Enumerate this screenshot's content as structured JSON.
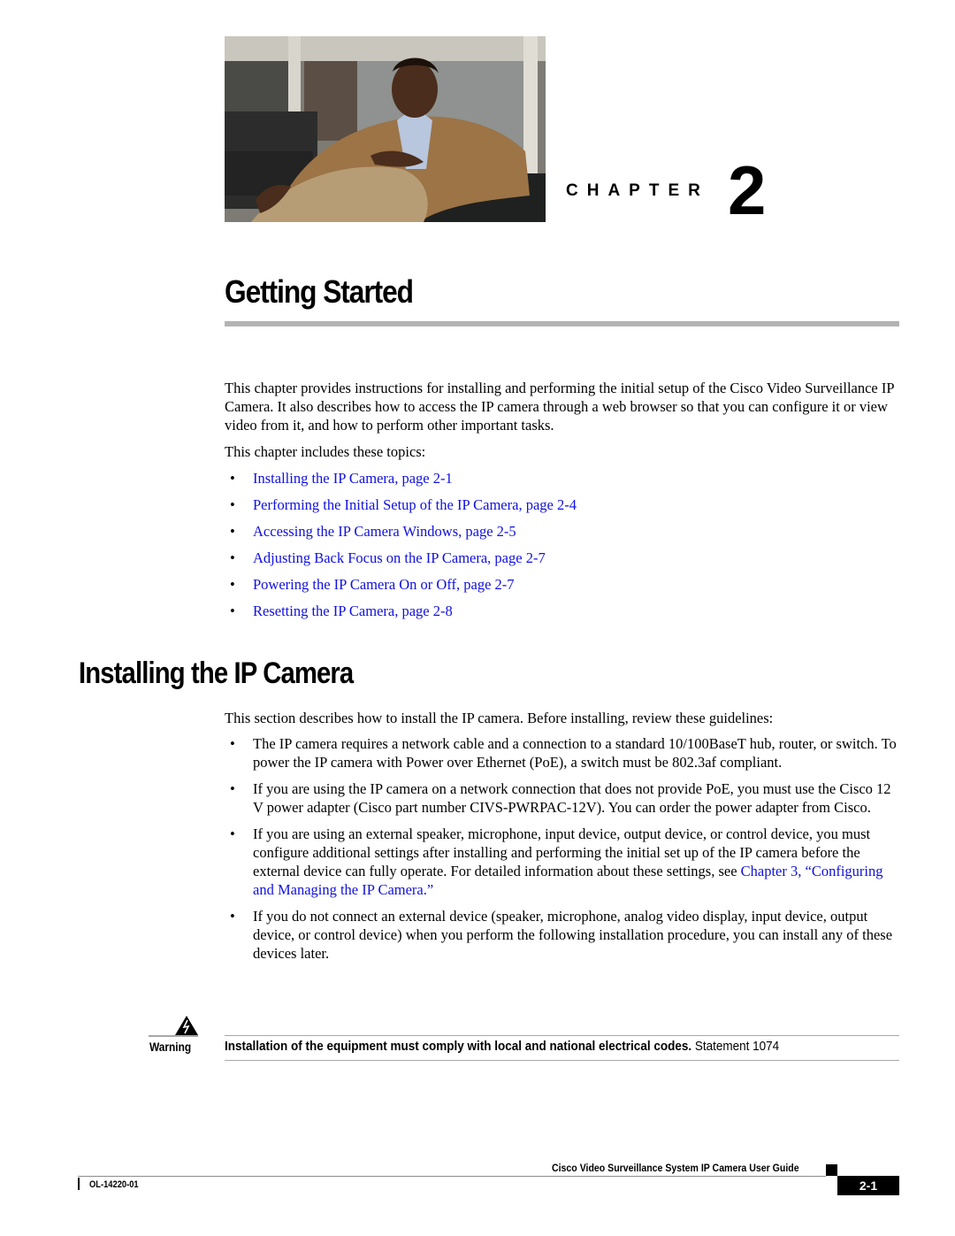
{
  "chapter": {
    "label": "CHAPTER",
    "number": "2",
    "title": "Getting Started",
    "photo_description": "portrait-photo-man-seated-in-office"
  },
  "intro": {
    "paragraph": "This chapter provides instructions for installing and performing the initial setup of the Cisco Video Surveillance IP Camera. It also describes how to access the IP camera through a web browser so that you can configure it or view video from it, and how to perform other important tasks.",
    "topics_lead": "This chapter includes these topics:",
    "topics": [
      {
        "label": "Installing the IP Camera, page 2-1"
      },
      {
        "label": "Performing the Initial Setup of the IP Camera, page 2-4"
      },
      {
        "label": "Accessing the IP Camera Windows, page 2-5"
      },
      {
        "label": "Adjusting Back Focus on the IP Camera, page 2-7"
      },
      {
        "label": "Powering the IP Camera On or Off, page 2-7"
      },
      {
        "label": "Resetting the IP Camera, page 2-8"
      }
    ],
    "bullet": "•"
  },
  "section": {
    "title": "Installing the IP Camera",
    "intro": "This section describes how to install the IP camera. Before installing, review these guidelines:",
    "guidelines": [
      {
        "text": "The IP camera requires a network cable and a connection to a standard 10/100BaseT hub, router, or switch. To power the IP camera with Power over Ethernet (PoE), a switch must be 802.3af compliant."
      },
      {
        "text": "If you are using the IP camera on a network connection that does not provide PoE, you must use the Cisco 12 V power adapter (Cisco part number CIVS-PWRPAC-12V). You can order the power adapter from Cisco."
      },
      {
        "text": "If you are using an external speaker, microphone, input device, output device, or control device, you must configure additional settings after installing and performing the initial set up of the IP camera before the external device can fully operate. For detailed information about these settings, see ",
        "link": "Chapter 3, “Configuring and Managing the IP Camera.”"
      },
      {
        "text": "If you do not connect an external device (speaker, microphone, analog video display, input device, output device, or control device) when you perform the following installation procedure, you can install any of these devices later."
      }
    ]
  },
  "warning": {
    "label": "Warning",
    "bold_text": "Installation of the equipment must comply with local and national electrical codes.",
    "statement": " Statement 1074"
  },
  "footer": {
    "guide_title": "Cisco Video Surveillance System IP Camera User Guide",
    "doc_number": "OL-14220-01",
    "page_number": "2-1"
  },
  "colors": {
    "link": "#1010e0",
    "rule": "#b3b3b3"
  }
}
